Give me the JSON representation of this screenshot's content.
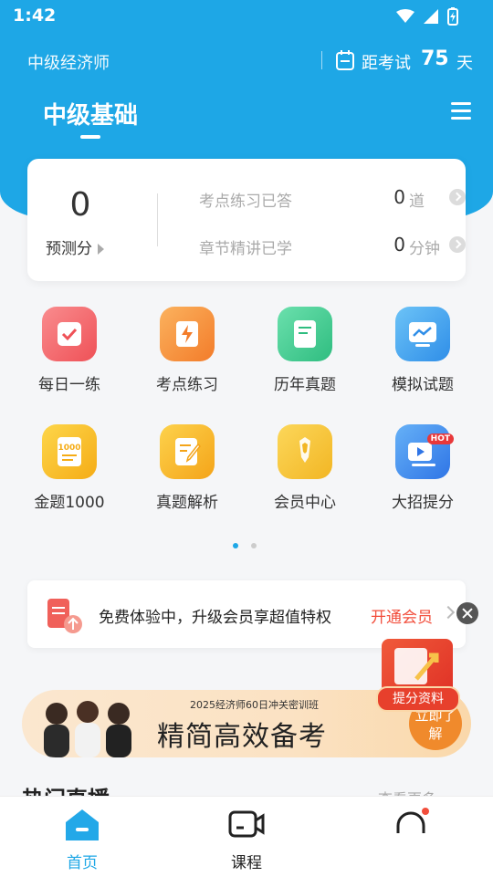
{
  "status": {
    "time": "1:42"
  },
  "header": {
    "exam_name": "中级经济师",
    "countdown_label": "距考试",
    "countdown_days": "75",
    "countdown_unit": "天",
    "subject_title": "中级基础"
  },
  "stats": {
    "score_value": "0",
    "score_label": "预测分",
    "practice_label": "考点练习已答",
    "practice_value": "0",
    "practice_unit": "道",
    "lecture_label": "章节精讲已学",
    "lecture_value": "0",
    "lecture_unit": "分钟"
  },
  "grid": [
    {
      "label": "每日一练",
      "icon": "calendar-check-icon",
      "color": "#f2666b"
    },
    {
      "label": "考点练习",
      "icon": "lightning-card-icon",
      "color": "#f6913a"
    },
    {
      "label": "历年真题",
      "icon": "document-leaf-icon",
      "color": "#3fc98f"
    },
    {
      "label": "模拟试题",
      "icon": "monitor-chart-icon",
      "color": "#3aa6ee"
    },
    {
      "label": "金题1000",
      "icon": "notebook-1000-icon",
      "color": "#f7b727"
    },
    {
      "label": "真题解析",
      "icon": "edit-note-icon",
      "color": "#f7b02a"
    },
    {
      "label": "会员中心",
      "icon": "crown-member-icon",
      "color": "#f5c232"
    },
    {
      "label": "大招提分",
      "icon": "video-hot-icon",
      "color": "#3e86ef",
      "badge": "HOT"
    }
  ],
  "member_banner": {
    "text": "免费体验中，升级会员享超值特权",
    "cta": "开通会员"
  },
  "promo": {
    "subtitle": "2025经济师60日冲关密训班",
    "title": "精简高效备考",
    "button": "立即了解"
  },
  "floating_ad": {
    "label": "提分资料"
  },
  "section": {
    "title": "热门直播",
    "more": "查看更多"
  },
  "tabbar": [
    {
      "label": "首页",
      "active": true
    },
    {
      "label": "课程",
      "active": false
    }
  ],
  "colors": {
    "brand": "#1ea7e6",
    "accent_red": "#f24e3c"
  }
}
